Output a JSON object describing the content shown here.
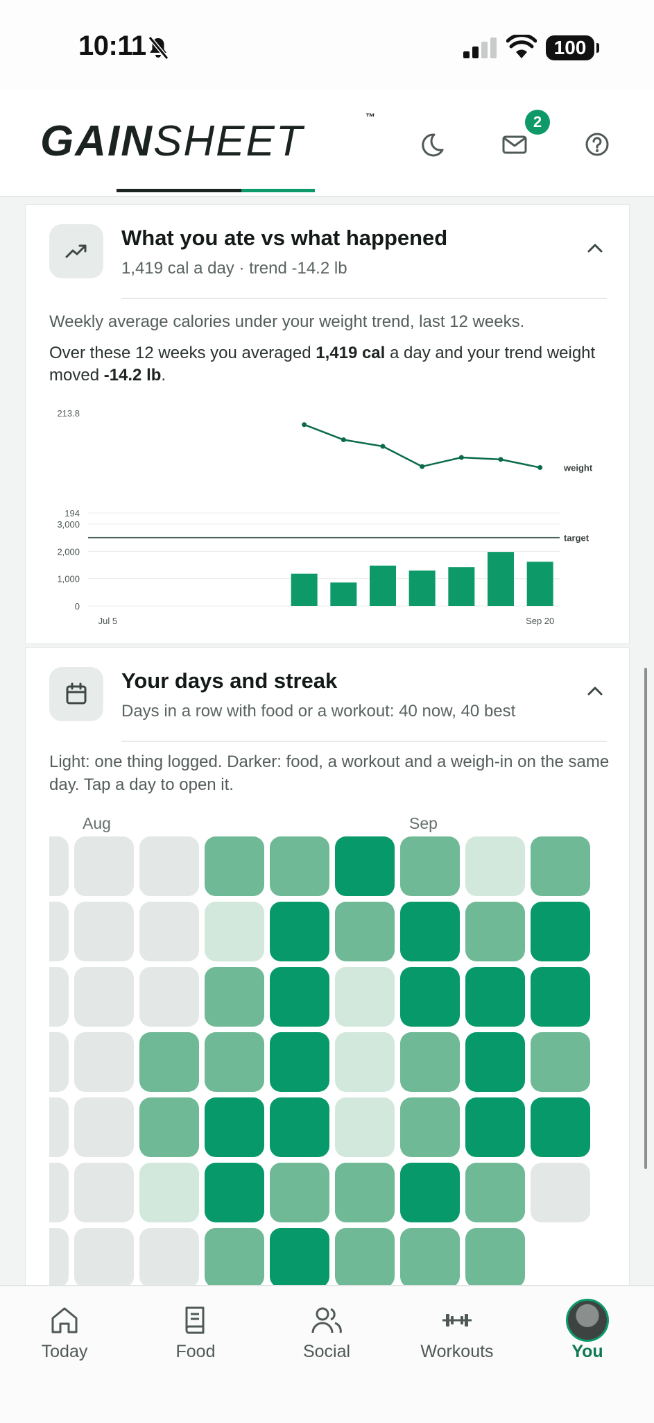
{
  "status_bar": {
    "time": "10:11",
    "battery": "100"
  },
  "header": {
    "logo_bold": "GAIN",
    "logo_light": "SHEET",
    "trademark": "™",
    "mail_badge": "2"
  },
  "colors": {
    "accent": "#0e9a68",
    "accent_dark": "#0e7a52",
    "text": "#1d2422",
    "muted": "#5a6461"
  },
  "cards": {
    "calories": {
      "icon": "trending-up-icon",
      "title": "What you ate vs what happened",
      "subtitle": "1,419 cal a day · trend -14.2 lb",
      "description": "Weekly average calories under your weight trend, last 12 weeks.",
      "summary_pre": "Over these 12 weeks you averaged ",
      "summary_cal": "1,419 cal",
      "summary_mid": " a day and your trend weight moved ",
      "summary_change": "-14.2 lb",
      "summary_post": "."
    },
    "streak": {
      "icon": "calendar-icon",
      "title": "Your days and streak",
      "subtitle": "Days in a row with food or a workout: 40 now, 40 best",
      "description": "Light: one thing logged. Darker: food, a workout and a weigh-in on the same day. Tap a day to open it.",
      "months": [
        "Aug",
        "Sep"
      ],
      "levels_by_column": [
        [
          0,
          0,
          0,
          0,
          0,
          0,
          0
        ],
        [
          0,
          0,
          0,
          0,
          0,
          0,
          0
        ],
        [
          0,
          0,
          0,
          2,
          2,
          1,
          0
        ],
        [
          2,
          1,
          2,
          2,
          3,
          3,
          2
        ],
        [
          2,
          3,
          3,
          3,
          3,
          2,
          3
        ],
        [
          3,
          2,
          1,
          1,
          1,
          2,
          2
        ],
        [
          2,
          3,
          3,
          2,
          2,
          3,
          2
        ],
        [
          1,
          2,
          3,
          3,
          3,
          2,
          2
        ],
        [
          2,
          3,
          3,
          2,
          3,
          0,
          null
        ]
      ]
    }
  },
  "chart_data": {
    "type": "line+bar",
    "weight": {
      "name": "weight",
      "ylim": [
        194,
        213.8
      ],
      "tick_labels": [
        "213.8",
        "194"
      ],
      "values": [
        211.5,
        208.5,
        207.2,
        203.2,
        205.0,
        204.6,
        203.0
      ]
    },
    "calories": {
      "ylim": [
        0,
        3000
      ],
      "ticks": [
        0,
        1000,
        2000,
        3000
      ],
      "tick_labels": [
        "0",
        "1,000",
        "2,000",
        "3,000"
      ],
      "target_name": "target",
      "target": 2500,
      "values": [
        1180,
        860,
        1480,
        1300,
        1420,
        1980,
        1620
      ]
    },
    "x_labels": [
      "Jul 5",
      "Sep 20"
    ],
    "weeks_total": 12,
    "weeks_with_data_start": 5
  },
  "tabs": [
    {
      "label": "Today",
      "icon": "home-icon"
    },
    {
      "label": "Food",
      "icon": "book-icon"
    },
    {
      "label": "Social",
      "icon": "people-icon"
    },
    {
      "label": "Workouts",
      "icon": "dumbbell-icon"
    },
    {
      "label": "You",
      "icon": "avatar"
    }
  ]
}
